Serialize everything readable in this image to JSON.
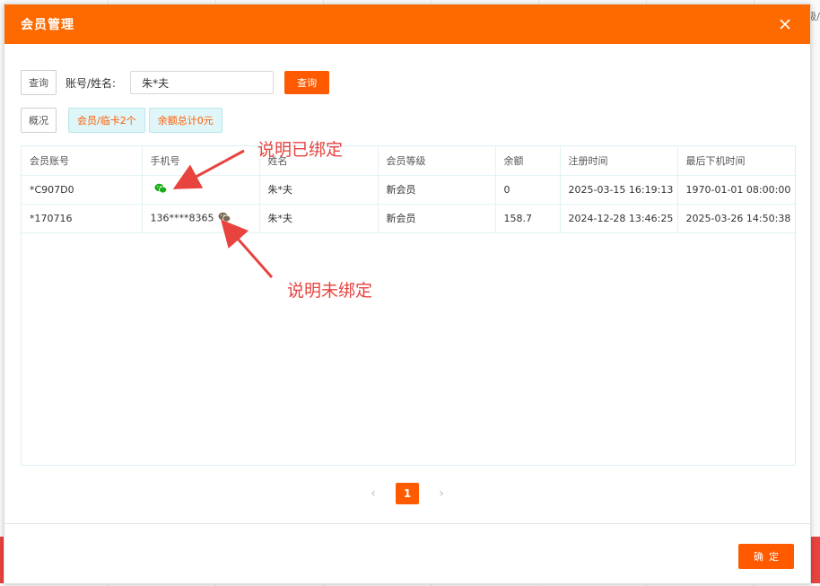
{
  "background": {
    "edge_text": "级/"
  },
  "modal": {
    "title": "会员管理",
    "close_icon": "close-icon"
  },
  "search": {
    "query_tab_label": "查询",
    "field_label": "账号/姓名:",
    "value": "朱*夫",
    "placeholder": "",
    "submit_label": "查询"
  },
  "summary": {
    "overview_label": "概况",
    "member_count": "会员/临卡2个",
    "balance_total": "余额总计0元"
  },
  "table": {
    "headers": [
      "会员账号",
      "手机号",
      "姓名",
      "会员等级",
      "余额",
      "注册时间",
      "最后下机时间"
    ],
    "rows": [
      {
        "account": "*C907D0",
        "phone": "",
        "wechat_bound": true,
        "name": "朱*夫",
        "level": "新会员",
        "balance": "0",
        "registered": "2025-03-15 16:19:13",
        "last_logout": "1970-01-01 08:00:00"
      },
      {
        "account": "*170716",
        "phone": "136****8365",
        "wechat_bound": false,
        "name": "朱*夫",
        "level": "新会员",
        "balance": "158.7",
        "registered": "2024-12-28 13:46:25",
        "last_logout": "2025-03-26 14:50:38"
      }
    ]
  },
  "pagination": {
    "current": "1",
    "prev_icon": "chevron-left-icon",
    "next_icon": "chevron-right-icon"
  },
  "footer": {
    "confirm_label": "确定"
  },
  "annotations": {
    "bound": "说明已绑定",
    "unbound": "说明未绑定"
  },
  "colors": {
    "header": "#ff6a00",
    "accent": "#ff5a00",
    "annotation": "#e8433f",
    "wechat_bound": "#1aad19",
    "wechat_unbound": "#7a6a55"
  }
}
